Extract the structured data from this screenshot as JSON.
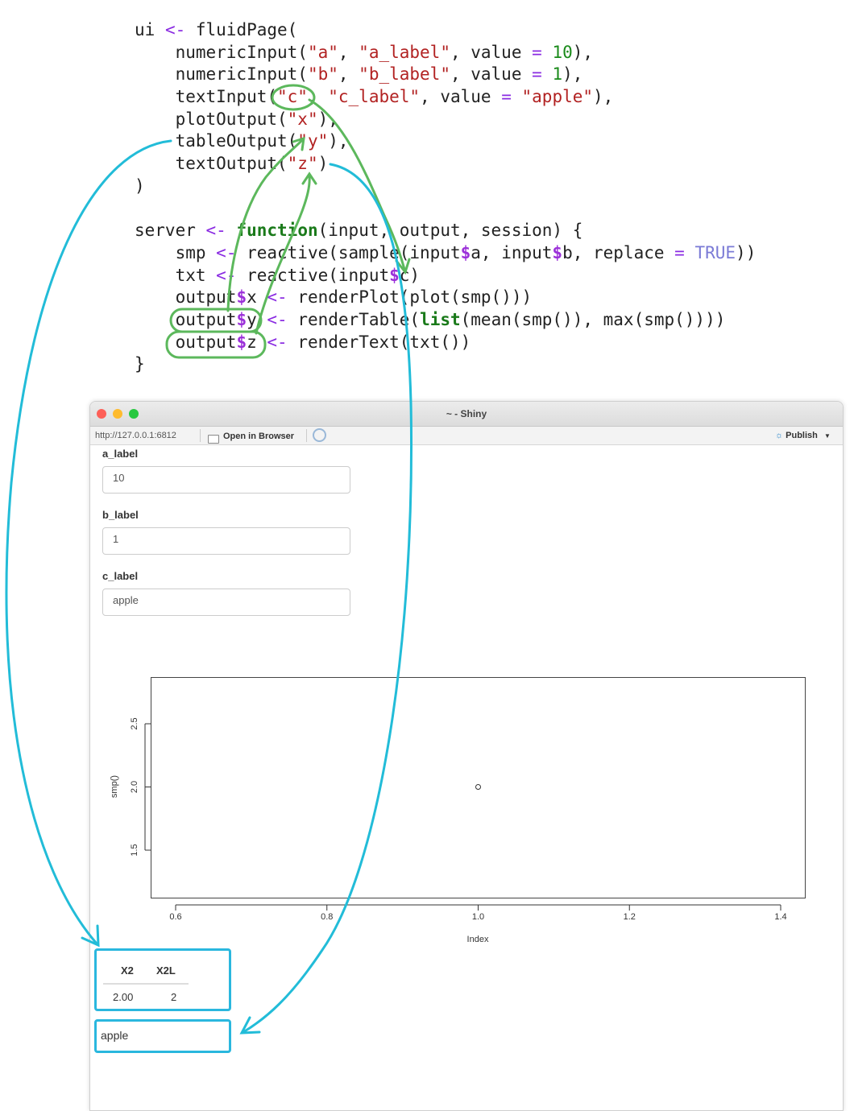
{
  "code": {
    "lines": [
      [
        {
          "t": "ui ",
          "c": ""
        },
        {
          "t": "<-",
          "c": "kw"
        },
        {
          "t": " fluidPage(",
          "c": ""
        }
      ],
      [
        {
          "t": "    numericInput(",
          "c": ""
        },
        {
          "t": "\"a\"",
          "c": "str"
        },
        {
          "t": ", ",
          "c": ""
        },
        {
          "t": "\"a_label\"",
          "c": "str"
        },
        {
          "t": ", value ",
          "c": ""
        },
        {
          "t": "=",
          "c": "kw"
        },
        {
          "t": " ",
          "c": ""
        },
        {
          "t": "10",
          "c": "num"
        },
        {
          "t": "),",
          "c": ""
        }
      ],
      [
        {
          "t": "    numericInput(",
          "c": ""
        },
        {
          "t": "\"b\"",
          "c": "str"
        },
        {
          "t": ", ",
          "c": ""
        },
        {
          "t": "\"b_label\"",
          "c": "str"
        },
        {
          "t": ", value ",
          "c": ""
        },
        {
          "t": "=",
          "c": "kw"
        },
        {
          "t": " ",
          "c": ""
        },
        {
          "t": "1",
          "c": "num"
        },
        {
          "t": "),",
          "c": ""
        }
      ],
      [
        {
          "t": "    textInput(",
          "c": ""
        },
        {
          "t": "\"c\"",
          "c": "str"
        },
        {
          "t": ", ",
          "c": ""
        },
        {
          "t": "\"c_label\"",
          "c": "str"
        },
        {
          "t": ", value ",
          "c": ""
        },
        {
          "t": "=",
          "c": "kw"
        },
        {
          "t": " ",
          "c": ""
        },
        {
          "t": "\"apple\"",
          "c": "str"
        },
        {
          "t": "),",
          "c": ""
        }
      ],
      [
        {
          "t": "    plotOutput(",
          "c": ""
        },
        {
          "t": "\"x\"",
          "c": "str"
        },
        {
          "t": "),",
          "c": ""
        }
      ],
      [
        {
          "t": "    tableOutput(",
          "c": ""
        },
        {
          "t": "\"y\"",
          "c": "str"
        },
        {
          "t": "),",
          "c": ""
        }
      ],
      [
        {
          "t": "    textOutput(",
          "c": ""
        },
        {
          "t": "\"z\"",
          "c": "str"
        },
        {
          "t": ")",
          "c": ""
        }
      ],
      [
        {
          "t": ")",
          "c": ""
        }
      ],
      [
        {
          "t": "",
          "c": ""
        }
      ],
      [
        {
          "t": "server ",
          "c": ""
        },
        {
          "t": "<-",
          "c": "kw"
        },
        {
          "t": " ",
          "c": ""
        },
        {
          "t": "function",
          "c": "fn"
        },
        {
          "t": "(input, output, session) {",
          "c": ""
        }
      ],
      [
        {
          "t": "    smp ",
          "c": ""
        },
        {
          "t": "<-",
          "c": "kw"
        },
        {
          "t": " reactive(sample(input",
          "c": ""
        },
        {
          "t": "$",
          "c": "dl"
        },
        {
          "t": "a, input",
          "c": ""
        },
        {
          "t": "$",
          "c": "dl"
        },
        {
          "t": "b, replace ",
          "c": ""
        },
        {
          "t": "=",
          "c": "kw"
        },
        {
          "t": " ",
          "c": ""
        },
        {
          "t": "TRUE",
          "c": "bool"
        },
        {
          "t": "))",
          "c": ""
        }
      ],
      [
        {
          "t": "    txt ",
          "c": ""
        },
        {
          "t": "<-",
          "c": "kw"
        },
        {
          "t": " reactive(input",
          "c": ""
        },
        {
          "t": "$",
          "c": "dl"
        },
        {
          "t": "c)",
          "c": ""
        }
      ],
      [
        {
          "t": "    output",
          "c": ""
        },
        {
          "t": "$",
          "c": "dl"
        },
        {
          "t": "x ",
          "c": ""
        },
        {
          "t": "<-",
          "c": "kw"
        },
        {
          "t": " renderPlot(plot(smp()))",
          "c": ""
        }
      ],
      [
        {
          "t": "    output",
          "c": ""
        },
        {
          "t": "$",
          "c": "dl"
        },
        {
          "t": "y ",
          "c": ""
        },
        {
          "t": "<-",
          "c": "kw"
        },
        {
          "t": " renderTable(",
          "c": ""
        },
        {
          "t": "list",
          "c": "fn"
        },
        {
          "t": "(mean(smp()), max(smp())))",
          "c": ""
        }
      ],
      [
        {
          "t": "    output",
          "c": ""
        },
        {
          "t": "$",
          "c": "dl"
        },
        {
          "t": "z ",
          "c": ""
        },
        {
          "t": "<-",
          "c": "kw"
        },
        {
          "t": " renderText(txt())",
          "c": ""
        }
      ],
      [
        {
          "t": "}",
          "c": ""
        }
      ]
    ]
  },
  "window": {
    "title": "~ - Shiny",
    "url": "http://127.0.0.1:6812",
    "open_browser": "Open in Browser",
    "publish": "Publish"
  },
  "inputs": {
    "a": {
      "label": "a_label",
      "value": "10"
    },
    "b": {
      "label": "b_label",
      "value": "1"
    },
    "c": {
      "label": "c_label",
      "value": "apple"
    }
  },
  "chart_data": {
    "type": "scatter",
    "x": [
      1.0
    ],
    "y": [
      2.0
    ],
    "xlabel": "Index",
    "ylabel": "smp()",
    "xlim": [
      0.6,
      1.4
    ],
    "ylim": [
      1.5,
      2.5
    ],
    "xticks": [
      "0.6",
      "0.8",
      "1.0",
      "1.2",
      "1.4"
    ],
    "yticks": [
      "1.5",
      "2.0",
      "2.5"
    ]
  },
  "table": {
    "headers": [
      "X2",
      "X2L"
    ],
    "rows": [
      [
        "2.00",
        "2"
      ]
    ]
  },
  "text_output": "apple",
  "colors": {
    "green_annotation": "#5cb85c",
    "cyan_annotation": "#22bcd8"
  }
}
